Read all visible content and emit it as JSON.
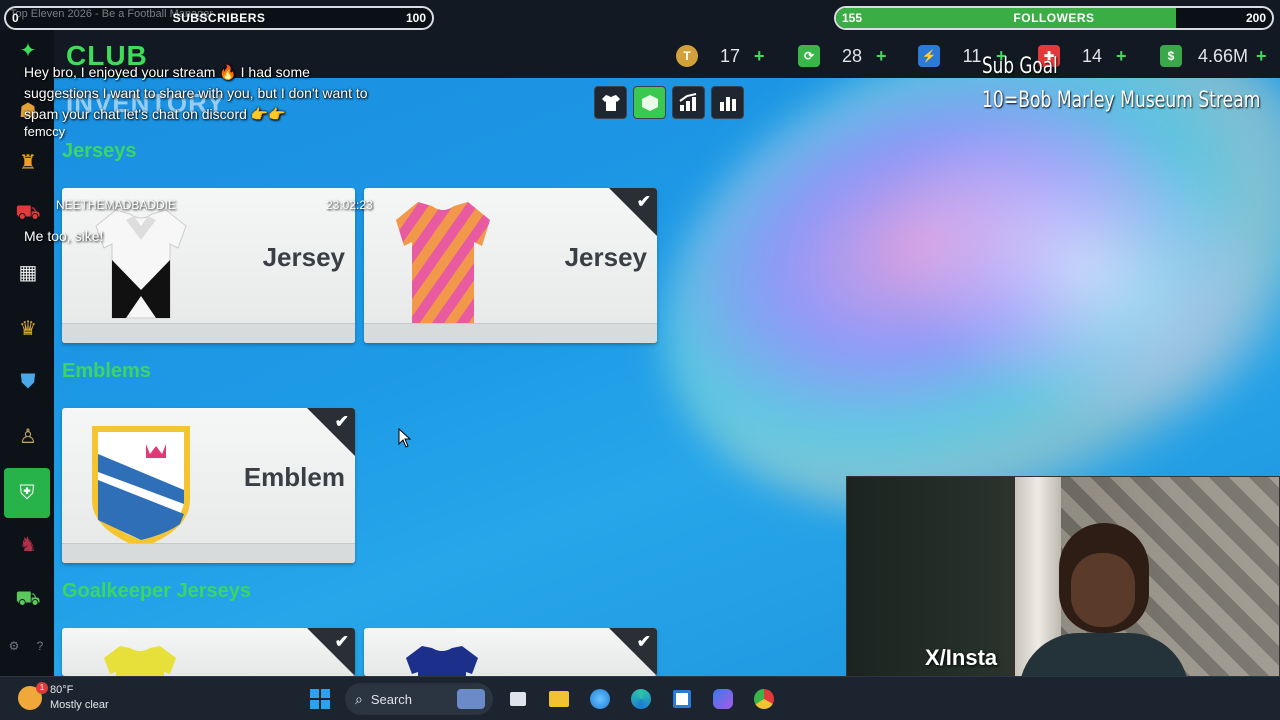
{
  "window": {
    "title": "Top Eleven 2026 - Be a Football Manager",
    "minimize": "—",
    "maximize": "▢",
    "close": "✕"
  },
  "subscribers_bar": {
    "left": "0",
    "label": "SUBSCRIBERS",
    "right": "100"
  },
  "followers_bar": {
    "left": "155",
    "label": "FOLLOWERS",
    "right": "200",
    "progress": 0.78
  },
  "header": {
    "club": "CLUB",
    "inventory": "INVENTORY"
  },
  "currencies": [
    {
      "icon": "token-icon",
      "value": "17",
      "color": "#d3a13a",
      "glyph": "T"
    },
    {
      "icon": "rest-icon",
      "value": "28",
      "color": "#3ab54a",
      "glyph": "⟳"
    },
    {
      "icon": "boost-icon",
      "value": "11",
      "color": "#2b7ad8",
      "glyph": "⚡"
    },
    {
      "icon": "medical-icon",
      "value": "14",
      "color": "#e23a3a",
      "glyph": "✚"
    },
    {
      "icon": "cash-icon",
      "value": "4.66M",
      "color": "#3aa84a",
      "glyph": "$"
    }
  ],
  "add_label": "+",
  "sub_goal": {
    "title": "Sub Goal",
    "detail": "10=Bob Marley Museum Stream"
  },
  "chat": {
    "message1": "Hey bro, I enjoyed your stream 🔥 I had some suggestions I want to share with you, but I don't want to spam your chat let's chat on discord 👉👉",
    "user1": "femccy",
    "user2": "NEETHEMADBADDIE",
    "time2": "23:02:23",
    "message2": "Me too, sike!"
  },
  "sections": {
    "jerseys": "Jerseys",
    "emblems": "Emblems",
    "goalkeeper": "Goalkeeper Jerseys"
  },
  "cards": {
    "jersey_label": "Jersey",
    "emblem_label": "Emblem",
    "check": "✔"
  },
  "colors": {
    "accent_green": "#39d660",
    "background_blue": "#1d9ae6",
    "card_bg": "#eef0f0"
  },
  "webcam": {
    "overlay_text": "X/Insta"
  },
  "taskbar": {
    "temperature": "80°F",
    "condition": "Mostly clear",
    "weather_badge": "1",
    "search_label": "Search"
  }
}
